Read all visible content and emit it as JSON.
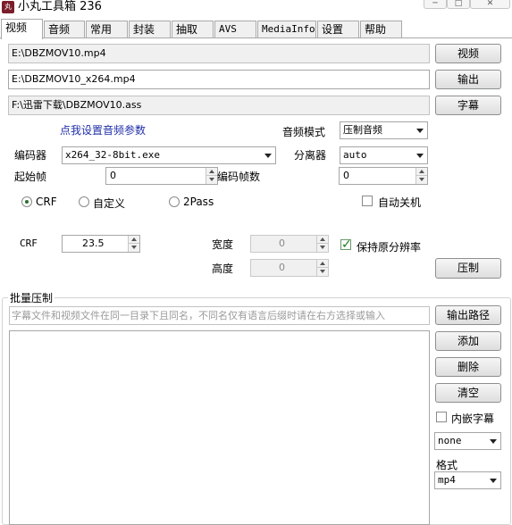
{
  "window": {
    "title": "小丸工具箱 236",
    "icon_text": "丸"
  },
  "tabs": [
    "视频",
    "音频",
    "常用",
    "封装",
    "抽取",
    "AVS",
    "MediaInfo",
    "设置",
    "帮助"
  ],
  "paths": {
    "video": "E:\\DBZMOV10.mp4",
    "output": "E:\\DBZMOV10_x264.mp4",
    "subtitle": "F:\\迅雷下载\\DBZMOV10.ass"
  },
  "buttons": {
    "video": "视频",
    "output": "输出",
    "subtitle": "字幕",
    "compress": "压制",
    "output_path": "输出路径",
    "add": "添加",
    "delete": "删除",
    "clear": "清空"
  },
  "audio_link": "点我设置音频参数",
  "audio_mode": {
    "label": "音频模式",
    "value": "压制音频"
  },
  "encoder": {
    "label": "编码器",
    "value": "x264_32-8bit.exe"
  },
  "splitter": {
    "label": "分离器",
    "value": "auto"
  },
  "start_frame": {
    "label": "起始帧",
    "value": "0"
  },
  "encode_frames": {
    "label": "编码帧数",
    "value": "0"
  },
  "auto_shutdown": {
    "label": "自动关机",
    "checked": false
  },
  "rate_modes": [
    {
      "label": "CRF",
      "checked": true
    },
    {
      "label": "自定义",
      "checked": false
    },
    {
      "label": "2Pass",
      "checked": false
    }
  ],
  "crf": {
    "label": "CRF",
    "value": "23.5"
  },
  "width": {
    "label": "宽度",
    "value": "0"
  },
  "height": {
    "label": "高度",
    "value": "0"
  },
  "keep_resolution": {
    "label": "保持原分辨率",
    "checked": true
  },
  "batch": {
    "title": "批量压制",
    "placeholder": "字幕文件和视频文件在同一目录下且同名，不同名仅有语言后缀时请在右方选择或输入",
    "embed_subtitle": {
      "label": "内嵌字幕",
      "checked": false
    },
    "subtitle_option": "none",
    "format_label": "格式",
    "format_value": "mp4"
  }
}
